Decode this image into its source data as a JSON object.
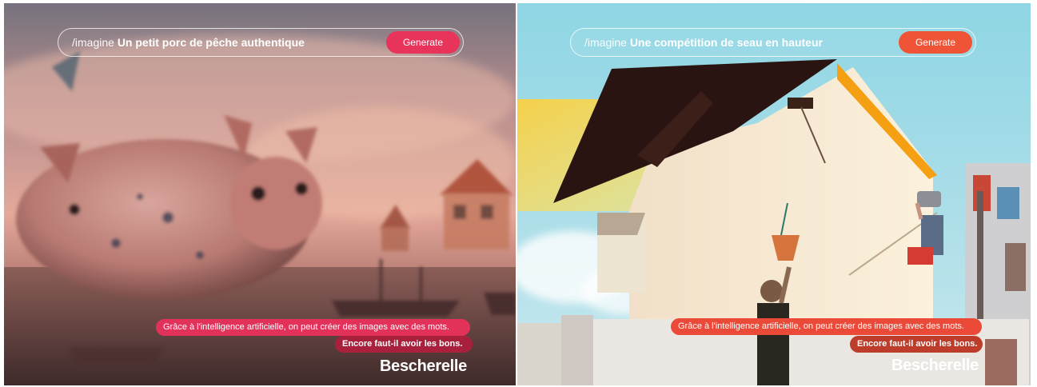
{
  "left_ad": {
    "prompt_command": "/imagine",
    "prompt_text": "Un petit porc de pêche authentique",
    "generate_label": "Generate",
    "tagline": "Grâce à l'intelligence artificielle, on peut créer des images avec des mots.",
    "sub_tagline": "Encore faut-il avoir les bons.",
    "brand": "Bescherelle",
    "accent_color": "#e8335a"
  },
  "right_ad": {
    "prompt_command": "/imagine",
    "prompt_text": "Une compétition de seau en hauteur",
    "generate_label": "Generate",
    "tagline": "Grâce à l'intelligence artificielle, on peut créer des images avec des mots.",
    "sub_tagline": "Encore faut-il avoir les bons.",
    "brand": "Bescherelle",
    "accent_color": "#ee5435"
  }
}
